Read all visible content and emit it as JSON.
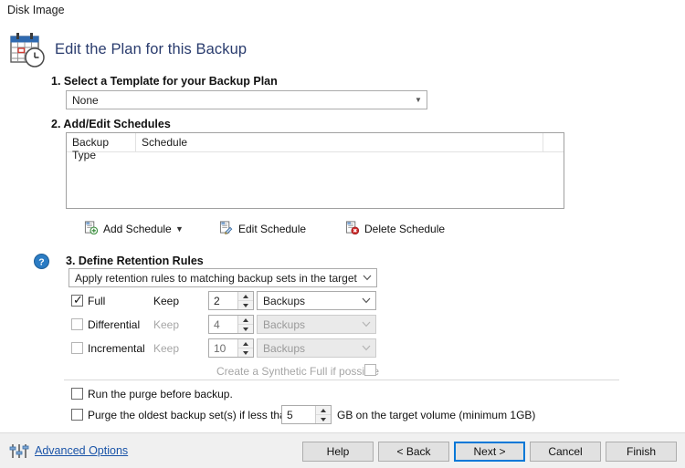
{
  "window": {
    "label": "Disk Image"
  },
  "header": {
    "title": "Edit the Plan for this Backup",
    "icon": "calendar-clock-icon",
    "title_color": "#2a3c6e"
  },
  "steps": {
    "step1": {
      "title": "1. Select a Template for your Backup Plan",
      "template_combo": {
        "value": "None",
        "placeholder": "None",
        "arrow_icon": "chevron-down-icon"
      }
    },
    "step2": {
      "title": "2. Add/Edit Schedules",
      "list": {
        "columns": [
          "Backup Type",
          "Schedule",
          ""
        ],
        "rows": []
      },
      "buttons": [
        {
          "label": "Add Schedule",
          "icon": "document-add-icon",
          "has_dropdown": true
        },
        {
          "label": "Edit Schedule",
          "icon": "document-edit-icon",
          "has_dropdown": false
        },
        {
          "label": "Delete Schedule",
          "icon": "document-delete-icon",
          "has_dropdown": false
        }
      ]
    },
    "step3": {
      "title": "3. Define Retention Rules",
      "help_icon": "help-circle-icon",
      "scope_combo": {
        "value": "Apply retention rules to matching backup sets in the target folder",
        "arrow_icon": "chevron-down-icon"
      },
      "rules": [
        {
          "name": "Full",
          "checked": true,
          "enabled": true,
          "keep_label": "Keep",
          "count": "2",
          "unit": "Backups"
        },
        {
          "name": "Differential",
          "checked": false,
          "enabled": false,
          "keep_label": "Keep",
          "count": "4",
          "unit": "Backups"
        },
        {
          "name": "Incremental",
          "checked": false,
          "enabled": false,
          "keep_label": "Keep",
          "count": "10",
          "unit": "Backups"
        }
      ],
      "synthetic": {
        "label": "Create a Synthetic Full if possible",
        "checked": false,
        "enabled": false
      }
    }
  },
  "purge": {
    "run_before": {
      "label": "Run the purge before backup.",
      "checked": false
    },
    "oldest": {
      "label": "Purge the oldest backup set(s) if less than",
      "checked": false,
      "value": "5",
      "suffix": "GB on the target volume (minimum 1GB)"
    }
  },
  "footer": {
    "advanced_options": {
      "label": "Advanced Options",
      "icon": "sliders-icon"
    },
    "buttons": [
      {
        "label": "Help",
        "focused": false
      },
      {
        "label": "< Back",
        "focused": false
      },
      {
        "label": "Next >",
        "focused": true
      },
      {
        "label": "Cancel",
        "focused": false
      },
      {
        "label": "Finish",
        "focused": false
      }
    ]
  }
}
